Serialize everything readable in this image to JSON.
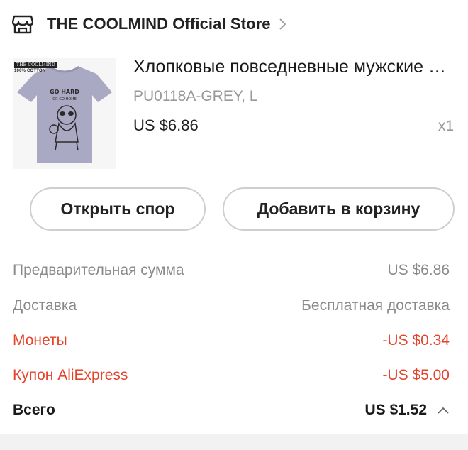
{
  "store": {
    "name": "THE COOLMIND Official Store",
    "icon": "store-icon",
    "chevron_icon": "chevron-right-icon"
  },
  "product": {
    "thumb_label_brand": "THE COOLMIND",
    "thumb_label_cotton": "100% COTTON",
    "thumb_print_line1": "GO HARD",
    "thumb_print_line2": "OR GO HOME",
    "title": "Хлопковые повседневные мужские футболки",
    "variant": "PU0118A-GREY, L",
    "price": "US $6.86",
    "quantity": "x1"
  },
  "actions": {
    "dispute_label": "Открыть спор",
    "cart_label": "Добавить в корзину"
  },
  "summary": {
    "subtotal_label": "Предварительная сумма",
    "subtotal_value": "US $6.86",
    "shipping_label": "Доставка",
    "shipping_value": "Бесплатная доставка",
    "coins_label": "Монеты",
    "coins_value": "-US $0.34",
    "coupon_label": "Купон AliExpress",
    "coupon_value": "-US $5.00",
    "total_label": "Всего",
    "total_value": "US $1.52",
    "collapse_icon": "chevron-up-icon"
  },
  "colors": {
    "accent_red": "#e6432b",
    "muted_text": "#8a8a8a",
    "border": "#cfcfcf",
    "shirt": "#a9a9c4"
  }
}
